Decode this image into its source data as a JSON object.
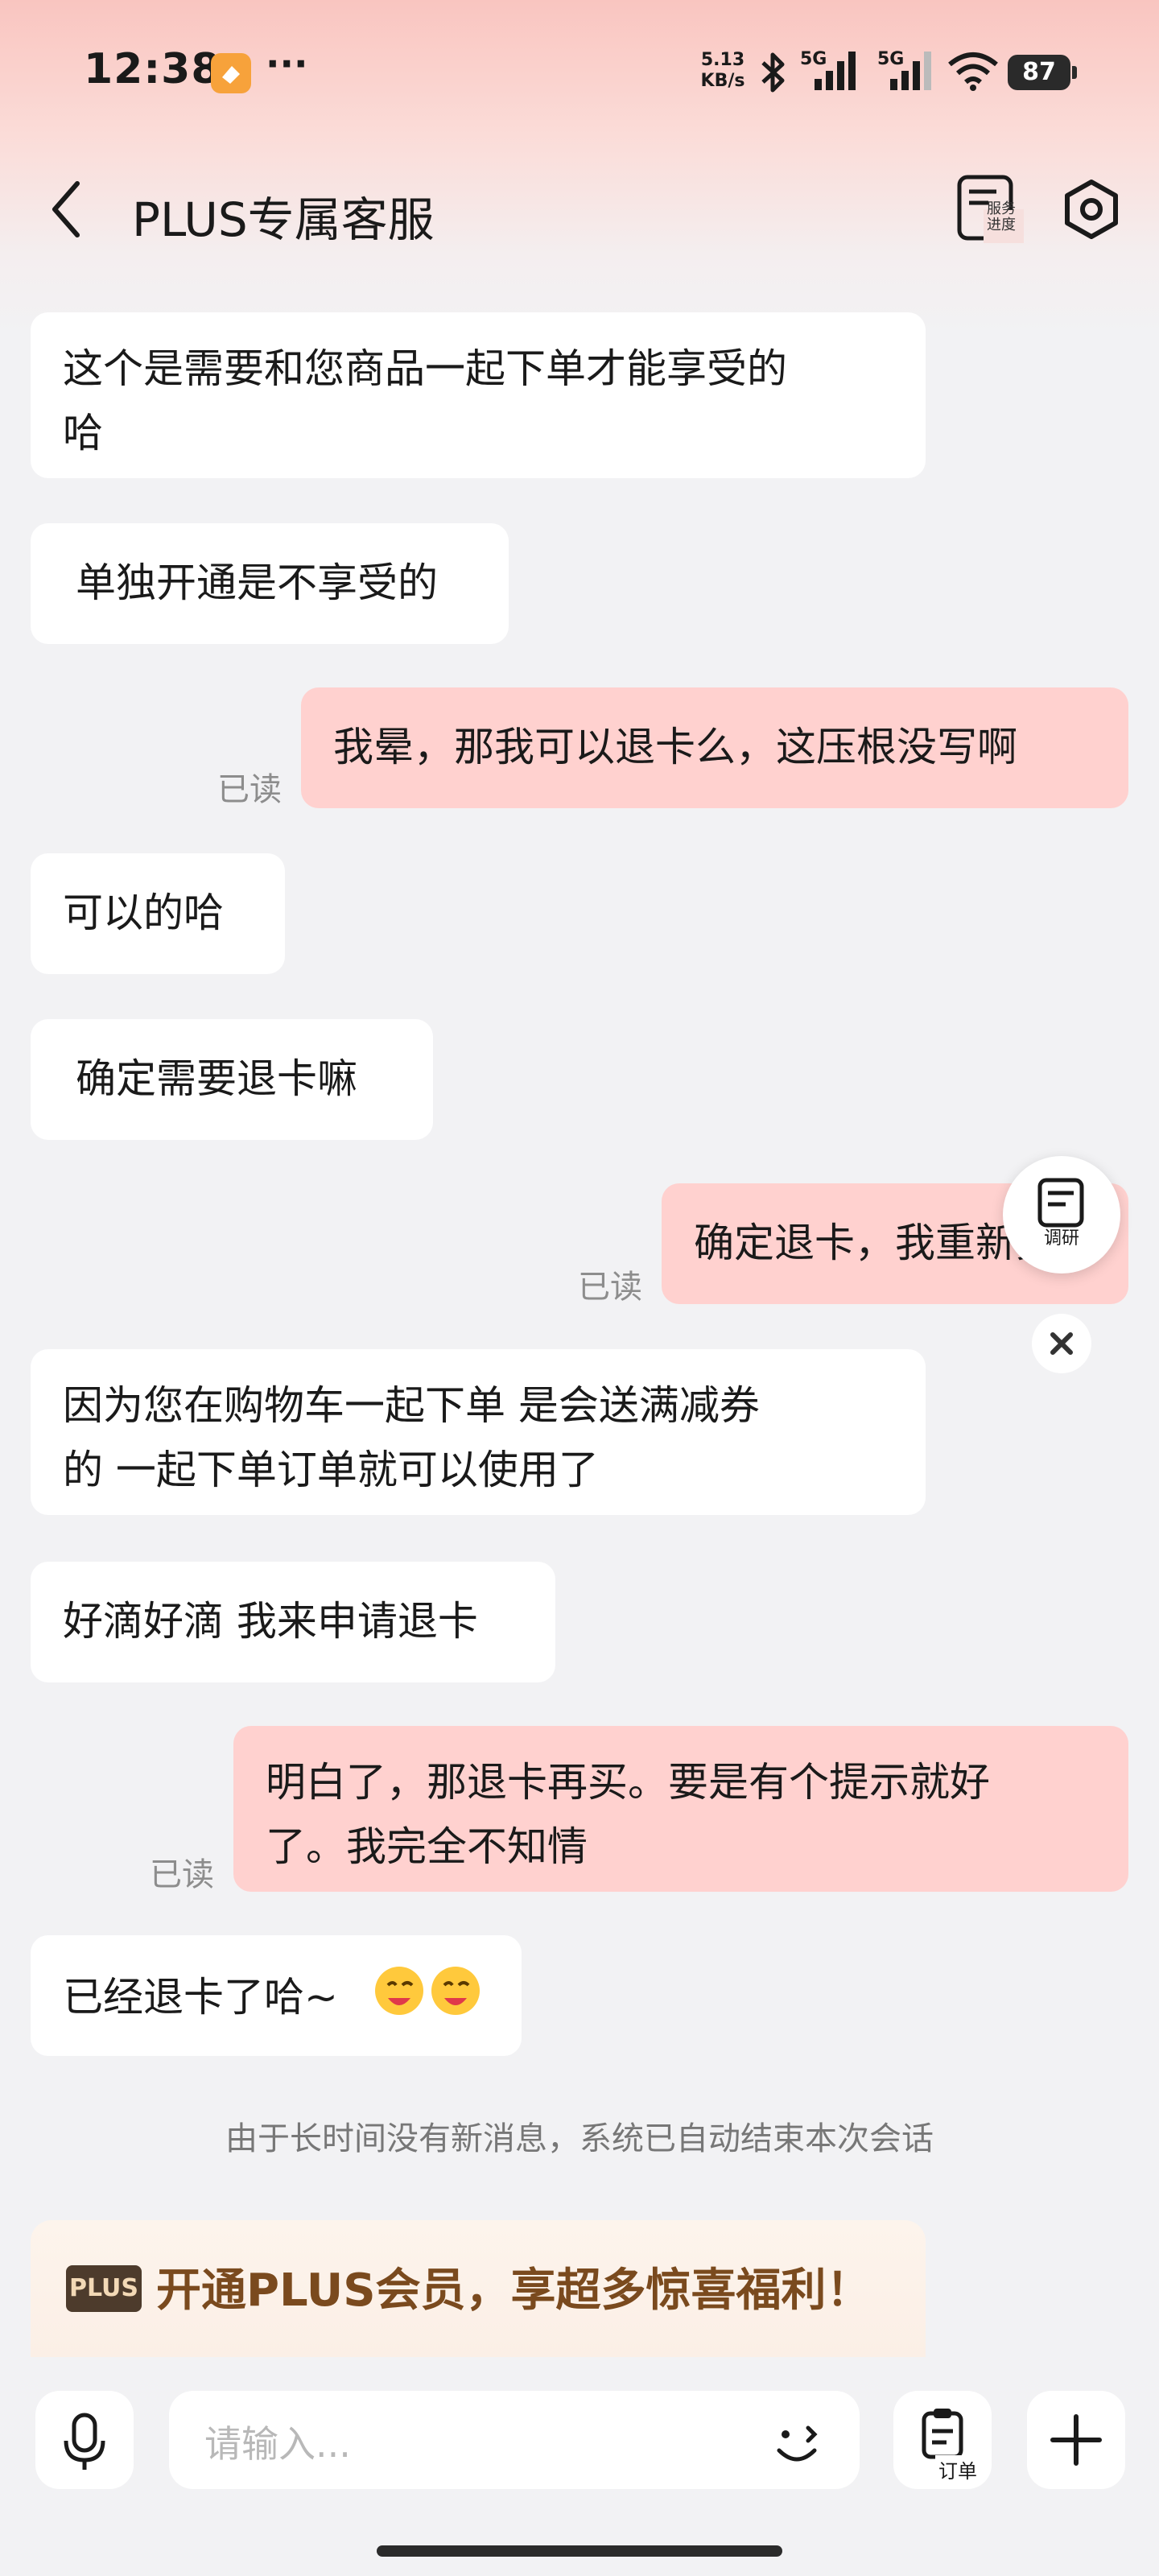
{
  "status_bar": {
    "time": "12:38",
    "more": "···",
    "net_speed_value": "5.13",
    "net_speed_unit": "KB/s",
    "signal1": "5G",
    "signal2": "5G",
    "battery": "87"
  },
  "header": {
    "title": "PLUS专属客服",
    "service_progress_label_1": "服务",
    "service_progress_label_2": "进度"
  },
  "messages": [
    {
      "from": "agent",
      "line1": "这个是需要和您商品一起下单才能享受的",
      "line2": "哈"
    },
    {
      "from": "agent",
      "line1": "单独开通是不享受的"
    },
    {
      "from": "me",
      "line1": "我晕，那我可以退卡么，这压根没写啊",
      "read": "已读"
    },
    {
      "from": "agent",
      "line1": "可以的哈"
    },
    {
      "from": "agent",
      "line1": "确定需要退卡嘛"
    },
    {
      "from": "me",
      "line1": "确定退卡，我重新买",
      "read": "已读"
    },
    {
      "from": "agent",
      "line1": "因为您在购物车一起下单  是会送满减券",
      "line2": "的  一起下单订单就可以使用了"
    },
    {
      "from": "agent",
      "line1": "好滴好滴 我来申请退卡"
    },
    {
      "from": "me",
      "line1": "明白了，那退卡再买。要是有个提示就好",
      "line2": "了。我完全不知情",
      "read": "已读"
    },
    {
      "from": "agent",
      "line1": "已经退卡了哈~"
    }
  ],
  "system_message": "由于长时间没有新消息，系统已自动结束本次会话",
  "promo": {
    "badge": "PLUS",
    "text": "开通PLUS会员，享超多惊喜福利！"
  },
  "survey_label": "调研",
  "input": {
    "placeholder": "请输入..."
  },
  "order_button_label": "订单",
  "colors": {
    "my_bubble": "#ffd1cf",
    "agent_bubble": "#ffffff",
    "promo_text": "#7a4a1e"
  }
}
